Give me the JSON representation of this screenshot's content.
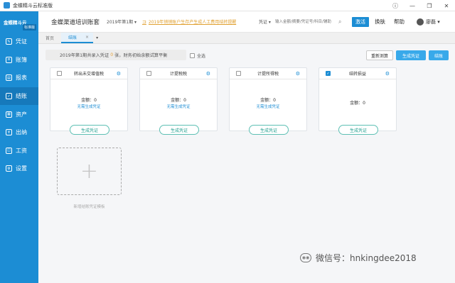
{
  "window": {
    "title": "金蝶精斗云标准版",
    "controls": [
      "ⓘ",
      "—",
      "❐",
      "✕"
    ]
  },
  "sidebar": {
    "brand": "金蝶精斗云",
    "edition": "标准版",
    "items": [
      {
        "label": "凭证",
        "icon": "voucher-icon",
        "glyph": "✎"
      },
      {
        "label": "账簿",
        "icon": "ledger-icon",
        "glyph": "≡"
      },
      {
        "label": "报表",
        "icon": "report-icon",
        "glyph": "▤"
      },
      {
        "label": "结账",
        "icon": "closing-icon",
        "glyph": "✓"
      },
      {
        "label": "资产",
        "icon": "asset-icon",
        "glyph": "▦"
      },
      {
        "label": "出纳",
        "icon": "cashier-icon",
        "glyph": "¥"
      },
      {
        "label": "工资",
        "icon": "salary-icon",
        "glyph": "◫"
      },
      {
        "label": "设置",
        "icon": "settings-icon",
        "glyph": "⚙"
      }
    ]
  },
  "header": {
    "company": "金蝶渠道培训账套",
    "period": "2019年第1期",
    "notice": "2019年销销账户生存产生成人工费用结转提醒",
    "search_type": "凭证",
    "search_placeholder": "输入金额/摘要/凭证号/科目/辅助",
    "activate": "激活",
    "switch": "换肤",
    "help": "帮助",
    "user": "廖磊"
  },
  "tabs": [
    {
      "label": "首页"
    },
    {
      "label": "结账"
    }
  ],
  "toolbar": {
    "info_prefix": "2019年第1期共录入凭证",
    "info_count": "0",
    "info_suffix": "张，财务初始余额试算平衡",
    "check_all": "全选",
    "recheck": "重新测算",
    "generate": "生成凭证",
    "close": "结账"
  },
  "cards": [
    {
      "title": "转出未交增值税",
      "checked": false,
      "amount": "金额：0",
      "status": "无需生成凭证",
      "button": "生成凭证"
    },
    {
      "title": "计提税税",
      "checked": false,
      "amount": "金额：0",
      "status": "无需生成凭证",
      "button": "生成凭证"
    },
    {
      "title": "计提所得税",
      "checked": false,
      "amount": "金额：0",
      "status": "无需生成凭证",
      "button": "生成凭证"
    },
    {
      "title": "结转损益",
      "checked": true,
      "amount": "金额：0",
      "status": "",
      "button": "生成凭证"
    }
  ],
  "add_template": "新增结账凭证模板",
  "watermark": "微信号：hnkingdee2018"
}
